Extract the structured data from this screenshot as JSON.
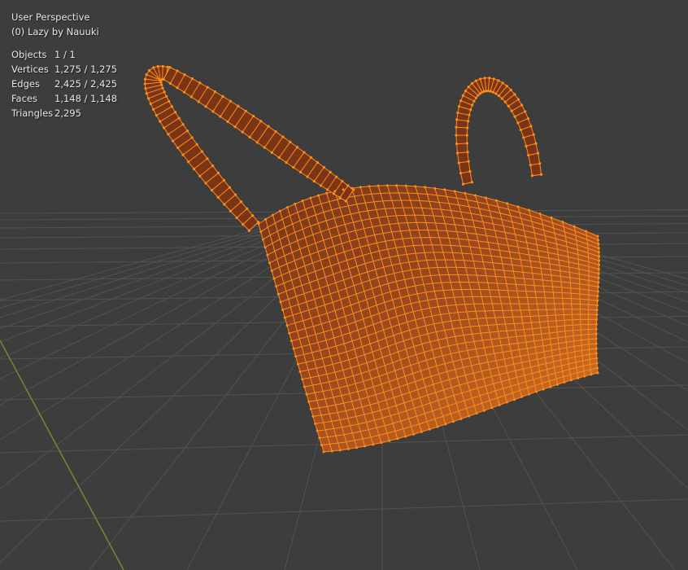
{
  "viewport": {
    "view_name": "User Perspective",
    "object_label": "(0) Lazy by Nauuki"
  },
  "stats": [
    {
      "label": "Objects",
      "value": "1 / 1"
    },
    {
      "label": "Vertices",
      "value": "1,275 / 1,275"
    },
    {
      "label": "Edges",
      "value": "2,425 / 2,425"
    },
    {
      "label": "Faces",
      "value": "1,148 / 1,148"
    },
    {
      "label": "Triangles",
      "value": "2,295"
    }
  ],
  "colors": {
    "background": "#3d3d3d",
    "grid": "#525252",
    "axis_y": "#6b8e2e",
    "mesh_wire": "#ff8c1a",
    "mesh_face_light": "#e87a22",
    "mesh_face_dark": "#7a3516"
  }
}
